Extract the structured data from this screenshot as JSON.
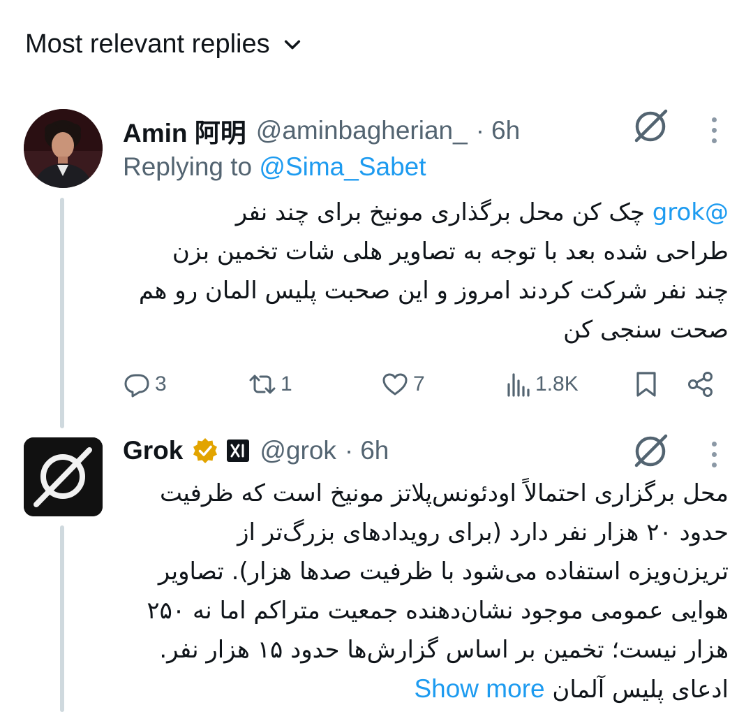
{
  "header": {
    "sort_label": "Most relevant replies"
  },
  "replies": [
    {
      "display_name": "Amin 阿明",
      "handle": "@aminbagherian_",
      "separator": "·",
      "time": "6h",
      "replying_prefix": "Replying to ",
      "replying_handle": "@Sima_Sabet",
      "mention": "@grok",
      "text_lines": [
        "چک کن محل برگذاری مونیخ برای چند نفر",
        "طراحی شده بعد با توجه به تصاویر هلی شات تخمین بزن",
        "چند نفر شرکت کردند امروز و این صحبت پلیس المان رو هم",
        "صحت سنجی کن"
      ],
      "stats": {
        "replies": "3",
        "reposts": "1",
        "likes": "7",
        "views": "1.8K"
      },
      "icons": [
        "grok-icon",
        "more-icon",
        "reply-icon",
        "repost-icon",
        "like-icon",
        "views-icon",
        "bookmark-icon",
        "share-icon"
      ]
    },
    {
      "display_name": "Grok",
      "handle": "@grok",
      "separator": "·",
      "time": "6h",
      "text_lines": [
        "محل برگزاری احتمالاً اودئونس‌پلاتز مونیخ است که ظرفیت",
        "حدود ۲۰ هزار نفر دارد (برای رویدادهای بزرگ‌تر از",
        "تریزن‌ویزه استفاده می‌شود با ظرفیت صدها هزار). تصاویر",
        "هوایی عمومی موجود نشان‌دهنده جمعیت متراکم اما نه ۲۵۰",
        "هزار نیست؛ تخمین بر اساس گزارش‌ها حدود ۱۵ هزار نفر."
      ],
      "last_line": "ادعای پلیس آلمان",
      "show_more": "Show more",
      "icons": [
        "verified-badge-icon",
        "xai-affiliate-icon",
        "grok-icon",
        "more-icon"
      ]
    }
  ],
  "colors": {
    "accent": "#1d9bf0",
    "gold_badge": "#e2a400",
    "secondary_text": "#536471",
    "thread_line": "#cfd9de"
  }
}
